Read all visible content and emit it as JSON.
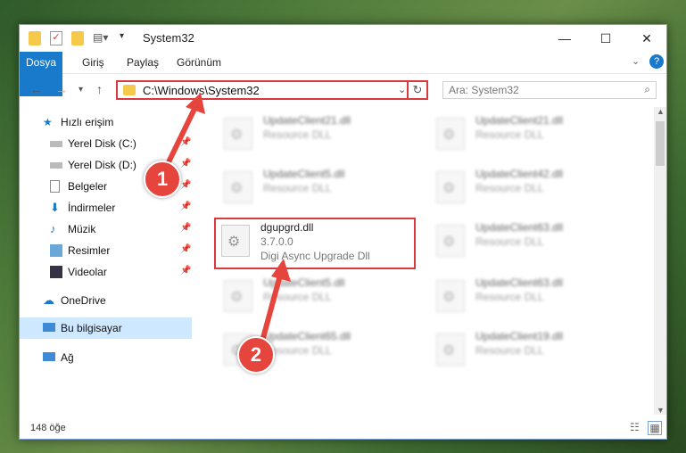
{
  "window": {
    "title": "System32",
    "controls": {
      "minimize": "—",
      "maximize": "☐",
      "close": "✕"
    }
  },
  "ribbon": {
    "tabs": [
      "Dosya",
      "Giriş",
      "Paylaş",
      "Görünüm"
    ]
  },
  "nav": {
    "address": "C:\\Windows\\System32",
    "search_placeholder": "Ara: System32"
  },
  "sidebar": {
    "items": [
      {
        "label": "Hızlı erişim",
        "icon": "star-icon"
      },
      {
        "label": "Yerel Disk (C:)",
        "icon": "drive-icon"
      },
      {
        "label": "Yerel Disk (D:)",
        "icon": "drive-icon"
      },
      {
        "label": "Belgeler",
        "icon": "documents-icon"
      },
      {
        "label": "İndirmeler",
        "icon": "download-icon"
      },
      {
        "label": "Müzik",
        "icon": "music-icon"
      },
      {
        "label": "Resimler",
        "icon": "pictures-icon"
      },
      {
        "label": "Videolar",
        "icon": "videos-icon"
      },
      {
        "label": "OneDrive",
        "icon": "cloud-icon"
      },
      {
        "label": "Bu bilgisayar",
        "icon": "computer-icon"
      },
      {
        "label": "Ağ",
        "icon": "network-icon"
      }
    ]
  },
  "files": {
    "left": [
      {
        "name": "UpdateClient21.dll",
        "type": "Resource DLL"
      },
      {
        "name": "UpdateClient5.dll",
        "type": "Resource DLL"
      },
      {
        "name": "UpdateClient5.dll",
        "type": "Resource DLL"
      },
      {
        "name": "UpdateClient65.dll",
        "type": "Resource DLL"
      }
    ],
    "right": [
      {
        "name": "UpdateClient21.dll",
        "type": "Resource DLL"
      },
      {
        "name": "UpdateClient42.dll",
        "type": "Resource DLL"
      },
      {
        "name": "UpdateClient63.dll",
        "type": "Resource DLL"
      },
      {
        "name": "UpdateClient63.dll",
        "type": "Resource DLL"
      },
      {
        "name": "UpdateClient19.dll",
        "type": "Resource DLL"
      }
    ],
    "highlighted": {
      "name": "dgupgrd.dll",
      "version": "3.7.0.0",
      "description": "Digi Async Upgrade Dll"
    }
  },
  "status": {
    "count": "148 öğe"
  },
  "callouts": [
    "1",
    "2"
  ],
  "colors": {
    "accent": "#1979ca",
    "highlight": "#d9393d",
    "callout": "#e5453d"
  }
}
